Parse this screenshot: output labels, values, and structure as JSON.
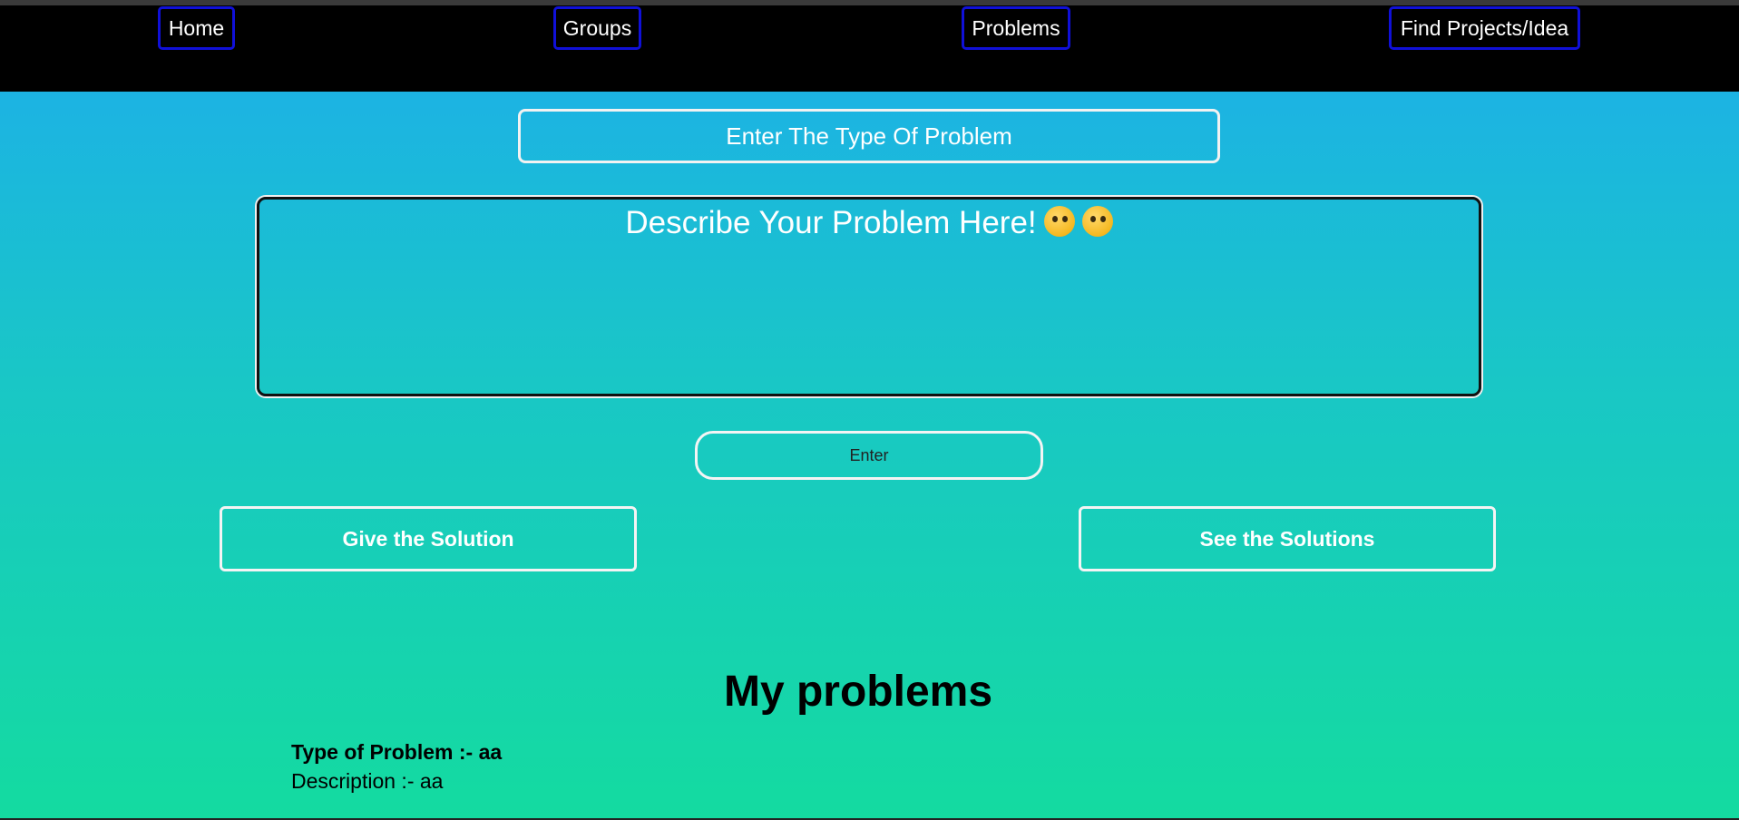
{
  "nav": {
    "home": "Home",
    "groups": "Groups",
    "problems": "Problems",
    "find": "Find Projects/Idea"
  },
  "form": {
    "type_placeholder": "Enter The Type Of Problem",
    "description_placeholder": "Describe Your Problem Here!",
    "description_emoji": "smiling-face-emoji",
    "enter_label": "Enter"
  },
  "actions": {
    "give_solution": "Give the Solution",
    "see_solutions": "See the Solutions"
  },
  "my_problems": {
    "heading": "My problems",
    "items": [
      {
        "type_label": "Type of Problem :- aa",
        "description_label": "Description :- aa"
      }
    ]
  },
  "colors": {
    "nav_border": "#1010d8",
    "gradient_top": "#1cb3e3",
    "gradient_bottom": "#14dba0"
  }
}
